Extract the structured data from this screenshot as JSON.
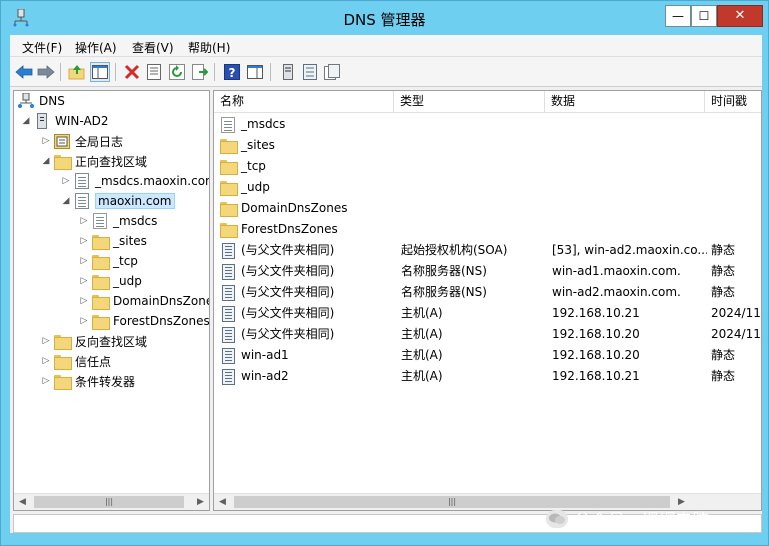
{
  "window": {
    "title": "DNS 管理器",
    "controls": {
      "minimize": "—",
      "maximize": "☐",
      "close": "✕"
    }
  },
  "menubar": {
    "items": [
      {
        "label": "文件(F)"
      },
      {
        "label": "操作(A)"
      },
      {
        "label": "查看(V)"
      },
      {
        "label": "帮助(H)"
      }
    ]
  },
  "toolbar": {
    "icons": [
      "back-arrow-icon",
      "forward-arrow-icon",
      "up-folder-icon",
      "show-hide-tree-icon",
      "delete-icon",
      "properties-icon",
      "refresh-icon",
      "export-list-icon",
      "help-icon",
      "action-pane-icon",
      "server-icon",
      "list-view-icon",
      "detail-view-icon"
    ],
    "colors": {
      "arrow": "#2a7fd4",
      "delete": "#d42a2a",
      "refresh": "#2a9a3a",
      "help": "#2a4fb0"
    }
  },
  "tree": {
    "root": "DNS",
    "server": "WIN-AD2",
    "global_logs": "全局日志",
    "forward_zones": "正向查找区域",
    "zone_msdcs": "_msdcs.maoxin.com",
    "zone_maoxin": "maoxin.com",
    "children": {
      "msdcs": "_msdcs",
      "sites": "_sites",
      "tcp": "_tcp",
      "udp": "_udp",
      "domaindns": "DomainDnsZones",
      "forestdns": "ForestDnsZones"
    },
    "reverse_zones": "反向查找区域",
    "trust_points": "信任点",
    "conditional_forwarders": "条件转发器"
  },
  "list": {
    "columns": {
      "name": "名称",
      "type": "类型",
      "data": "数据",
      "timestamp": "时间戳"
    },
    "rows": [
      {
        "name": "_msdcs",
        "type": "",
        "data": "",
        "timestamp": "",
        "icon": "zone-delegation-icon"
      },
      {
        "name": "_sites",
        "type": "",
        "data": "",
        "timestamp": "",
        "icon": "folder-icon"
      },
      {
        "name": "_tcp",
        "type": "",
        "data": "",
        "timestamp": "",
        "icon": "folder-icon"
      },
      {
        "name": "_udp",
        "type": "",
        "data": "",
        "timestamp": "",
        "icon": "folder-icon"
      },
      {
        "name": "DomainDnsZones",
        "type": "",
        "data": "",
        "timestamp": "",
        "icon": "folder-icon"
      },
      {
        "name": "ForestDnsZones",
        "type": "",
        "data": "",
        "timestamp": "",
        "icon": "folder-icon"
      },
      {
        "name": "(与父文件夹相同)",
        "type": "起始授权机构(SOA)",
        "data": "[53], win-ad2.maoxin.co...",
        "timestamp": "静态",
        "icon": "record-icon"
      },
      {
        "name": "(与父文件夹相同)",
        "type": "名称服务器(NS)",
        "data": "win-ad1.maoxin.com.",
        "timestamp": "静态",
        "icon": "record-icon"
      },
      {
        "name": "(与父文件夹相同)",
        "type": "名称服务器(NS)",
        "data": "win-ad2.maoxin.com.",
        "timestamp": "静态",
        "icon": "record-icon"
      },
      {
        "name": "(与父文件夹相同)",
        "type": "主机(A)",
        "data": "192.168.10.21",
        "timestamp": "2024/11/",
        "icon": "record-icon"
      },
      {
        "name": "(与父文件夹相同)",
        "type": "主机(A)",
        "data": "192.168.10.20",
        "timestamp": "2024/11/",
        "icon": "record-icon"
      },
      {
        "name": "win-ad1",
        "type": "主机(A)",
        "data": "192.168.10.20",
        "timestamp": "静态",
        "icon": "record-icon"
      },
      {
        "name": "win-ad2",
        "type": "主机(A)",
        "data": "192.168.10.21",
        "timestamp": "静态",
        "icon": "record-icon"
      }
    ]
  },
  "watermark": "公众号 · 帽帽电脑"
}
